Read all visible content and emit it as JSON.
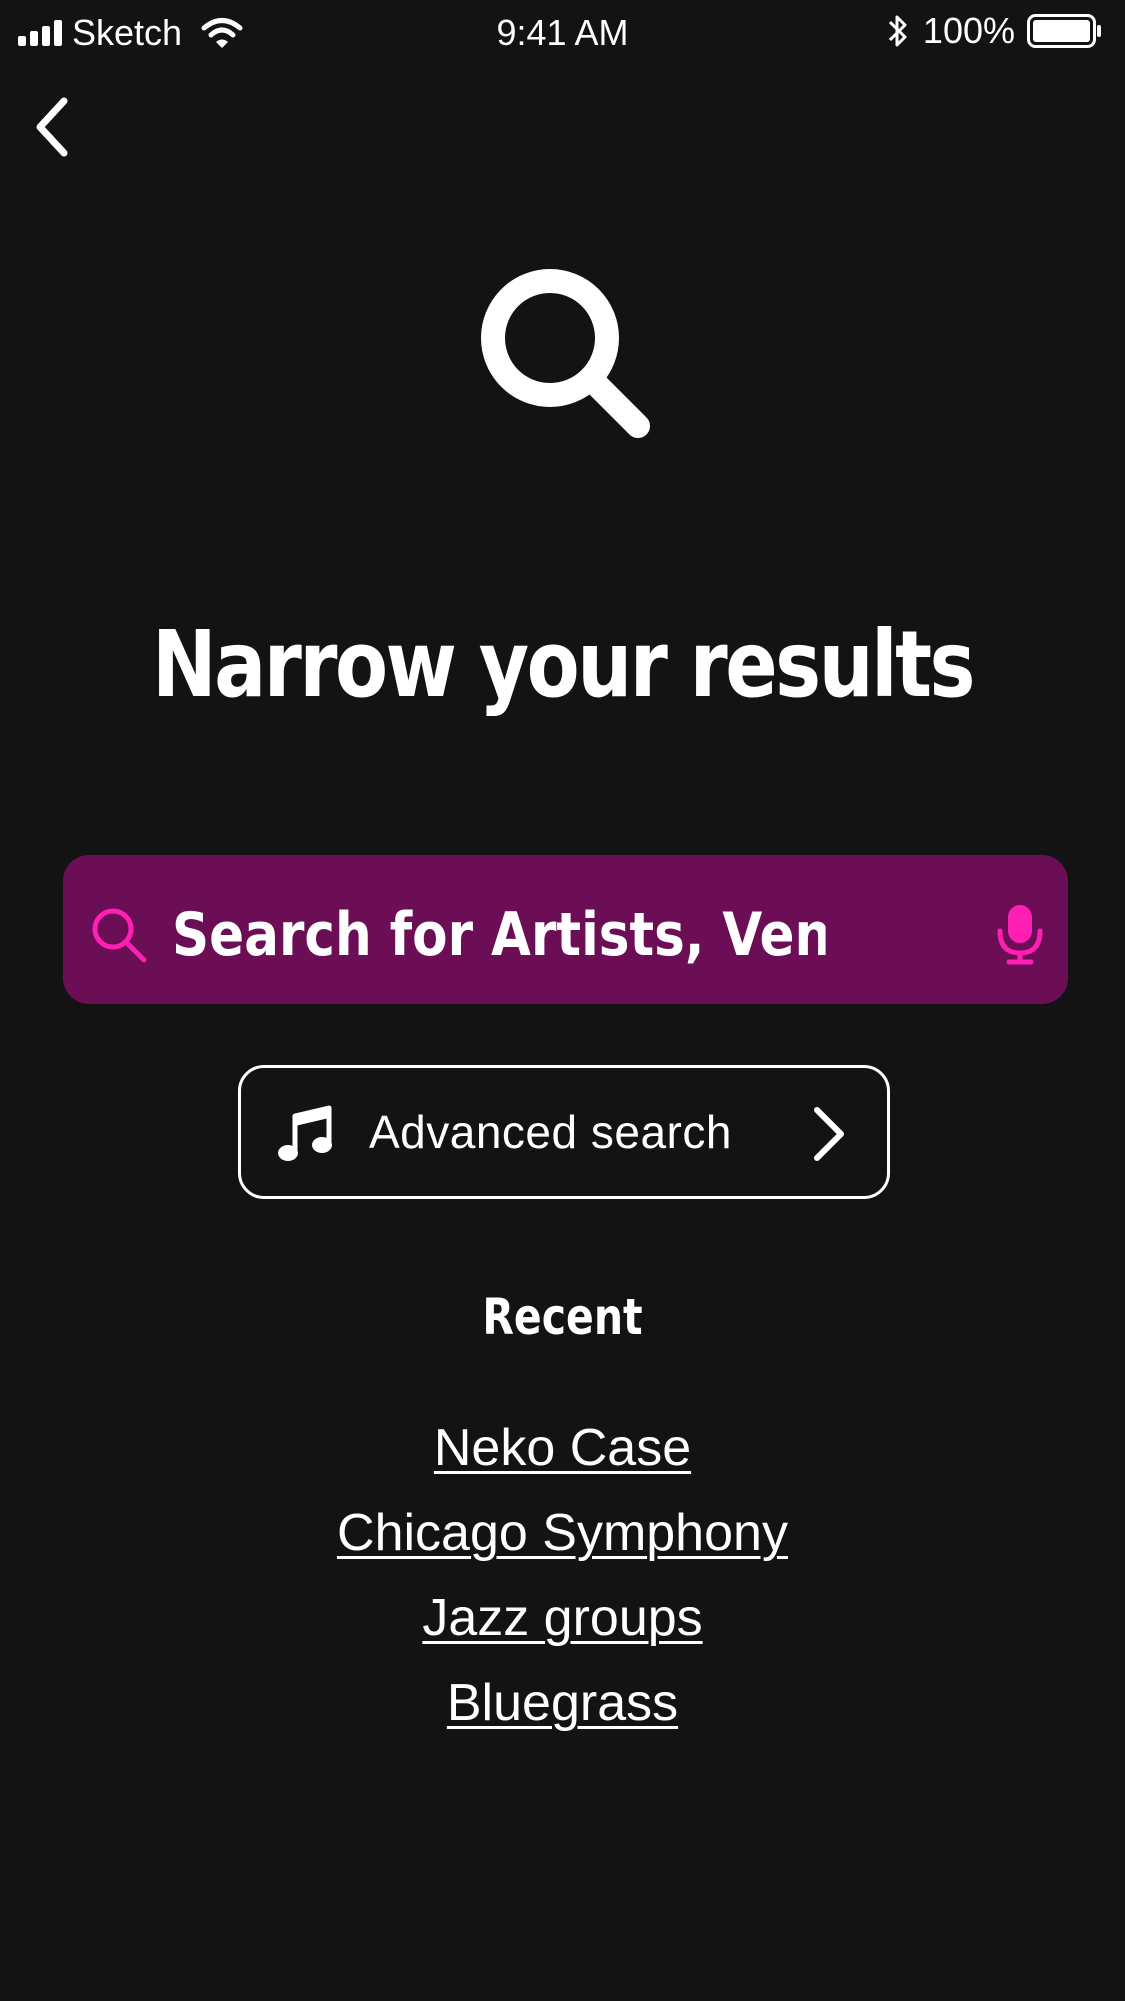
{
  "status_bar": {
    "carrier": "Sketch",
    "time": "9:41 AM",
    "battery": "100%"
  },
  "icons": {
    "back": "chevron-left-icon",
    "hero": "search-icon",
    "search": "search-icon",
    "mic": "microphone-icon",
    "advanced": "music-note-icon",
    "advanced_chevron": "chevron-right-icon"
  },
  "header": {
    "title": "Narrow your results"
  },
  "search": {
    "placeholder": "Search for Artists, Venues ...",
    "bar_color": "#6c0e55",
    "accent_color": "#ff1fb4"
  },
  "advanced_search": {
    "label": "Advanced search"
  },
  "recent": {
    "heading": "Recent",
    "items": [
      {
        "label": "Neko Case"
      },
      {
        "label": "Chicago Symphony"
      },
      {
        "label": "Jazz groups"
      },
      {
        "label": "Bluegrass"
      }
    ]
  },
  "colors": {
    "background": "#131313",
    "text": "#ffffff"
  }
}
